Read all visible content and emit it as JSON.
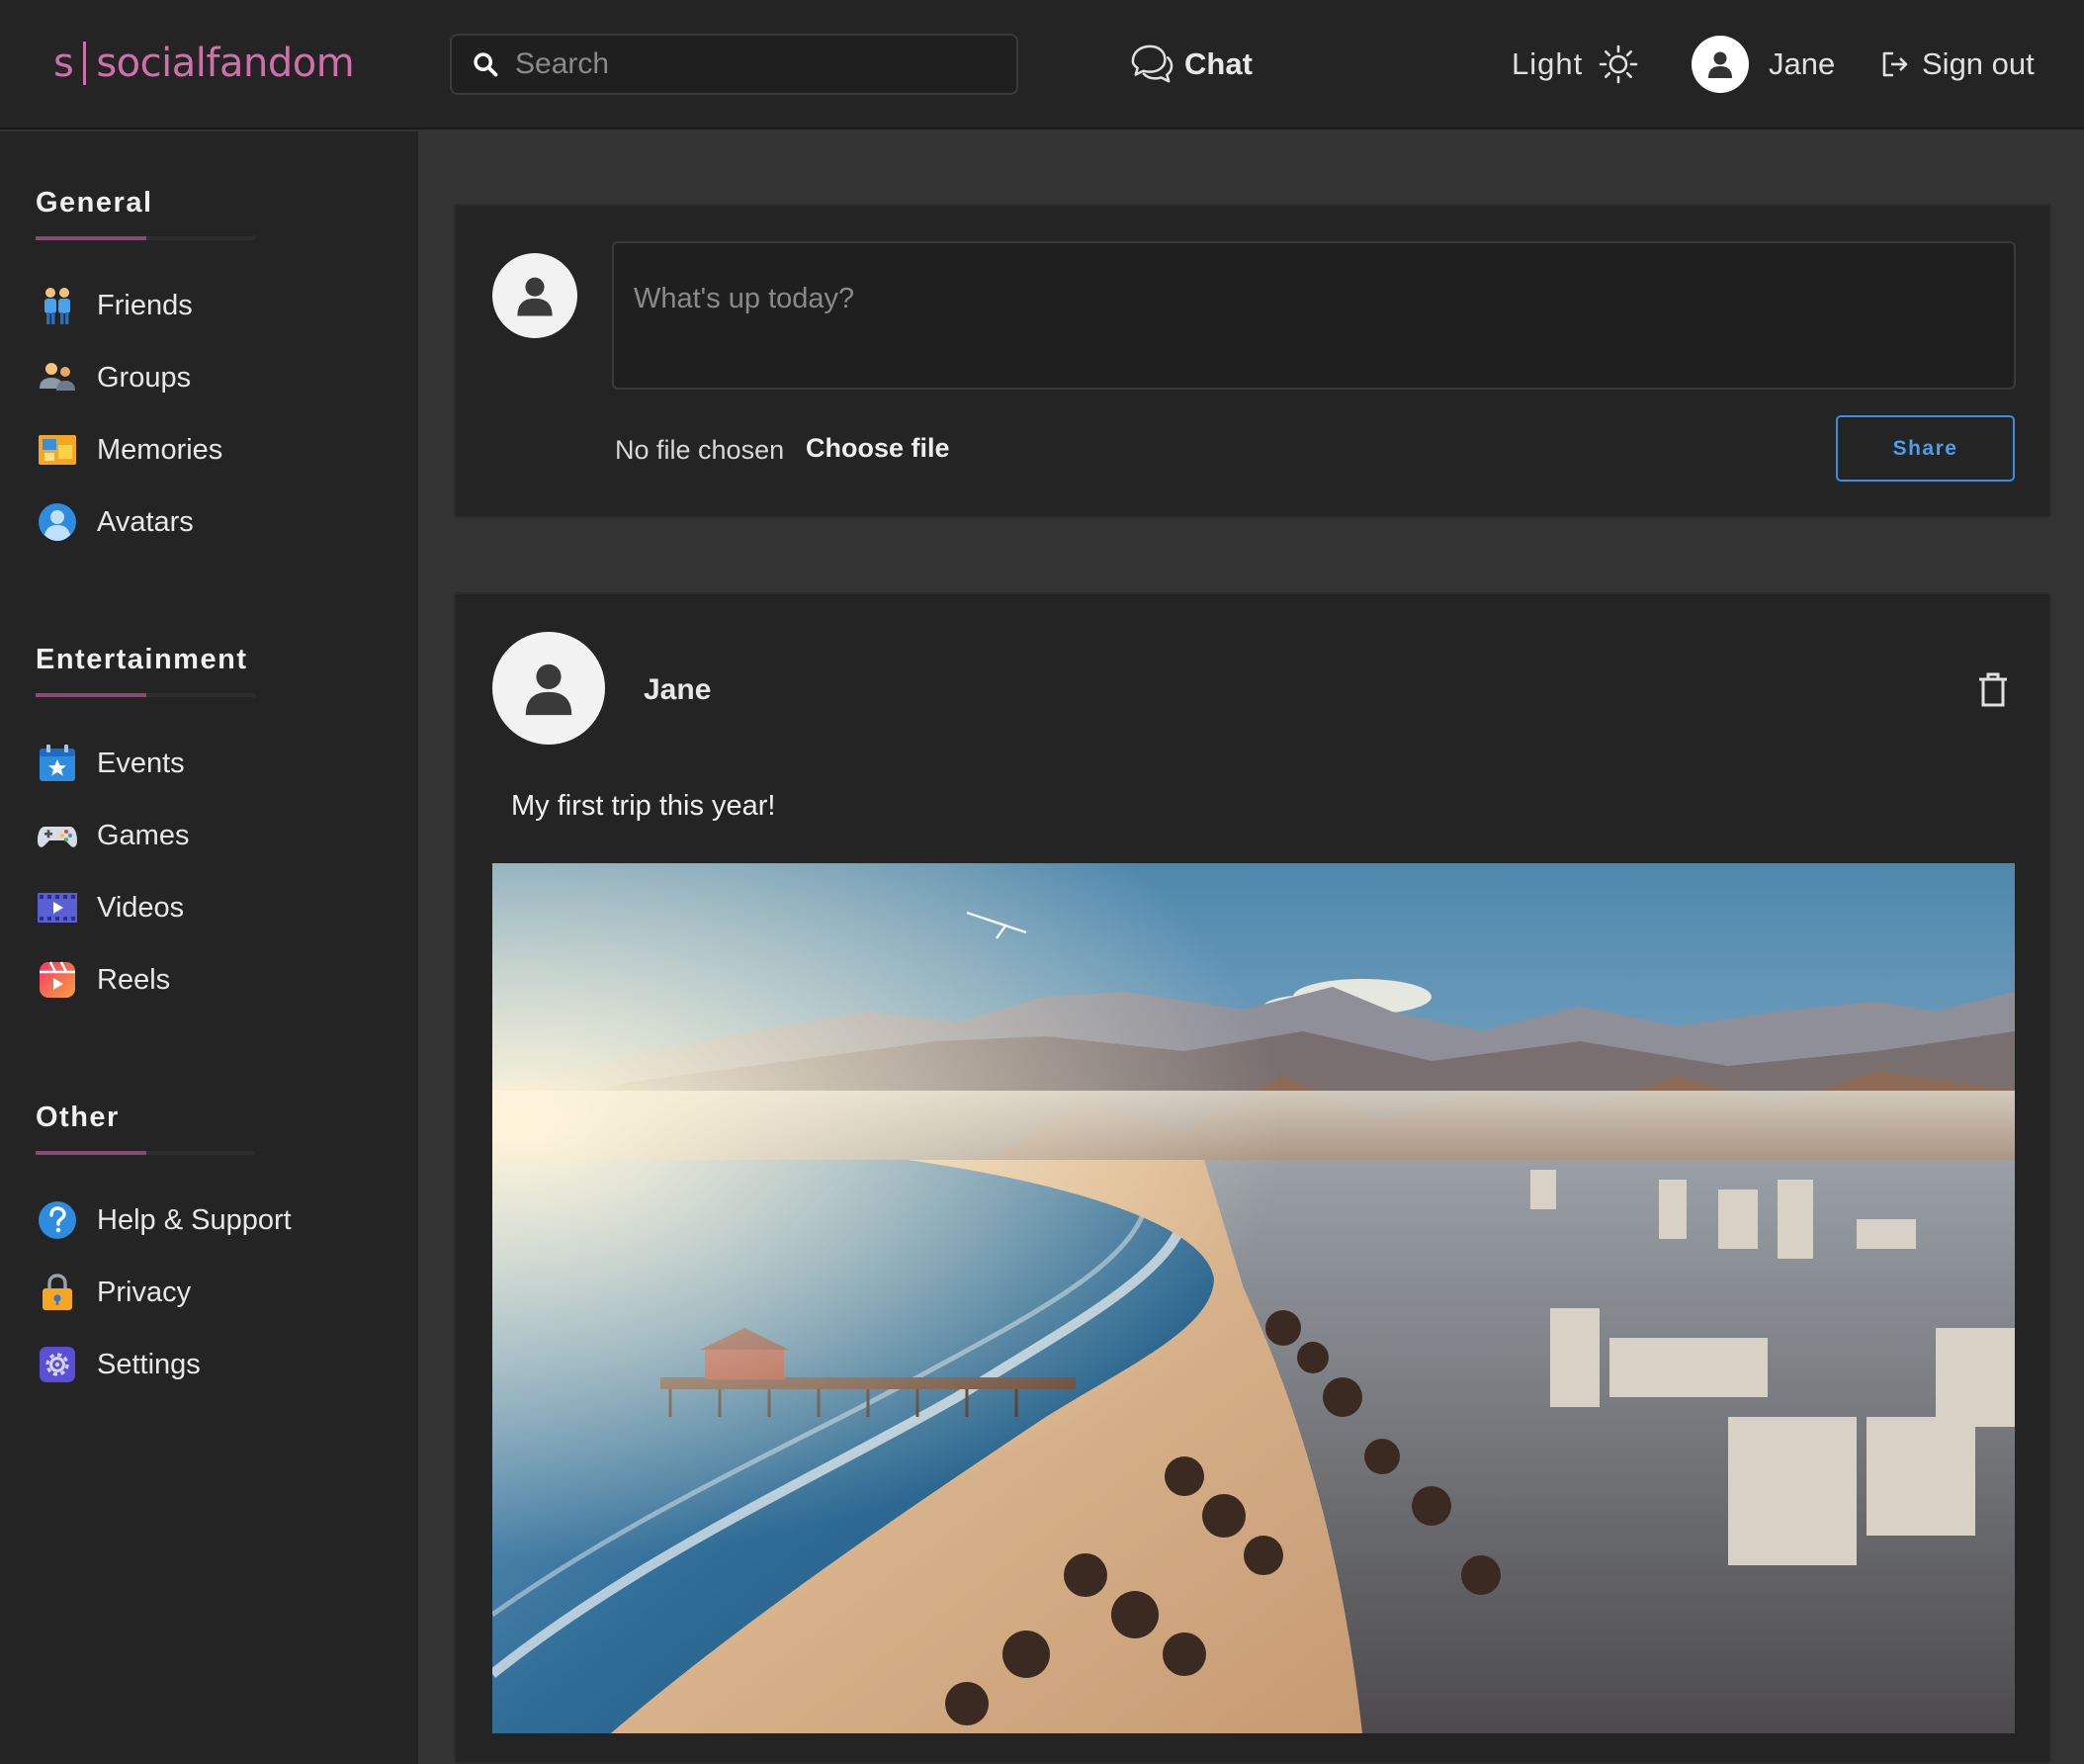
{
  "header": {
    "logo_letter": "s",
    "logo_name": "socialfandom",
    "search_placeholder": "Search",
    "chat_label": "Chat",
    "theme_label": "Light",
    "user_name": "Jane",
    "signout_label": "Sign out"
  },
  "sidebar": {
    "sections": [
      {
        "title": "General",
        "items": [
          {
            "label": "Friends",
            "icon": "friends-icon"
          },
          {
            "label": "Groups",
            "icon": "groups-icon"
          },
          {
            "label": "Memories",
            "icon": "memories-icon"
          },
          {
            "label": "Avatars",
            "icon": "avatars-icon"
          }
        ]
      },
      {
        "title": "Entertainment",
        "items": [
          {
            "label": "Events",
            "icon": "events-icon"
          },
          {
            "label": "Games",
            "icon": "games-icon"
          },
          {
            "label": "Videos",
            "icon": "videos-icon"
          },
          {
            "label": "Reels",
            "icon": "reels-icon"
          }
        ]
      },
      {
        "title": "Other",
        "items": [
          {
            "label": "Help & Support",
            "icon": "help-icon"
          },
          {
            "label": "Privacy",
            "icon": "privacy-icon"
          },
          {
            "label": "Settings",
            "icon": "settings-icon"
          }
        ]
      }
    ]
  },
  "composer": {
    "placeholder": "What's up today?",
    "file_status": "No file chosen",
    "choose_file_label": "Choose file",
    "share_label": "Share"
  },
  "post": {
    "author": "Jane",
    "text": "My first trip this year!",
    "image_icon": "beach-city-photo"
  },
  "colors": {
    "brand": "#cf70ad",
    "accent_blue": "#4a9ff0",
    "background": "#333333",
    "panel": "#242424"
  }
}
